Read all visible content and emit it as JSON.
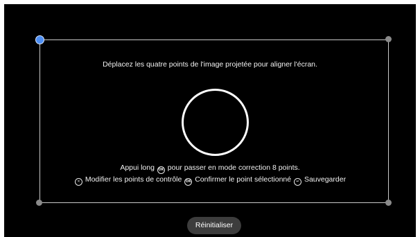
{
  "instructions": {
    "main": "Déplacez les quatre points de l'image projetée pour aligner l'écran.",
    "long_press_prefix": "Appui long",
    "long_press_suffix": "pour passer en mode correction 8 points.",
    "modify_label": "Modifier les points de contrôle",
    "confirm_label": "Confirmer le point sélectionné",
    "save_label": "Sauvegarder"
  },
  "icons": {
    "ok_glyph": "OK",
    "cross_glyph": "✕",
    "back_glyph": "↩"
  },
  "buttons": {
    "reset_label": "Réinitialiser"
  },
  "colors": {
    "background": "#000000",
    "frame": "#c9c9c9",
    "selected_point": "#4d8ef3",
    "corner_point": "#8a8a8a",
    "button_bg": "#3d3d3d"
  }
}
